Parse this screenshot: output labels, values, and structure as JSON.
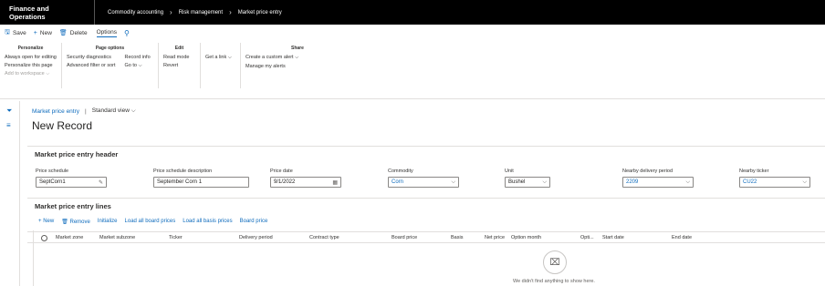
{
  "topbar": {
    "app_title": "Finance and Operations",
    "breadcrumbs": [
      "Commodity accounting",
      "Risk management",
      "Market price entry"
    ]
  },
  "actions": {
    "save": "Save",
    "new": "New",
    "delete": "Delete",
    "options": "Options"
  },
  "ribbon": {
    "personalize": {
      "title": "Personalize",
      "items": [
        "Always open for editing",
        "Personalize this page",
        "Add to workspace"
      ]
    },
    "page_options": {
      "title": "Page options",
      "col1": [
        "Security diagnostics",
        "Advanced filter or sort"
      ],
      "col2": [
        "Record info",
        "Go to"
      ]
    },
    "edit": {
      "title": "Edit",
      "items": [
        "Read mode",
        "Revert"
      ]
    },
    "get_link": "Get a link",
    "share": {
      "title": "Share",
      "items": [
        "Create a custom alert",
        "Manage my alerts"
      ]
    }
  },
  "page": {
    "breadcrumb_link": "Market price entry",
    "view": "Standard view",
    "title": "New Record"
  },
  "header_section": {
    "title": "Market price entry header",
    "fields": [
      {
        "label": "Price schedule",
        "value": "SeptCorn1"
      },
      {
        "label": "Price schedule description",
        "value": "September Corn 1"
      },
      {
        "label": "Price date",
        "value": "9/1/2022"
      },
      {
        "label": "Commodity",
        "value": "Corn"
      },
      {
        "label": "Unit",
        "value": "Bushel"
      },
      {
        "label": "Nearby delivery period",
        "value": "2209"
      },
      {
        "label": "Nearby ticker",
        "value": "CU22"
      }
    ]
  },
  "lines_section": {
    "title": "Market price entry lines",
    "toolbar": [
      "New",
      "Remove",
      "Initialize",
      "Load all board prices",
      "Load all basis prices",
      "Board price"
    ],
    "columns": [
      "Market zone",
      "Market subzone",
      "Ticker",
      "Delivery period",
      "Contract type",
      "Board price",
      "Basis",
      "Net price",
      "Option month",
      "Opti...",
      "Start date",
      "End date"
    ],
    "empty_text": "We didn't find anything to show here."
  },
  "colors": {
    "accent": "#0f6cbd",
    "topbar": "#000000"
  }
}
